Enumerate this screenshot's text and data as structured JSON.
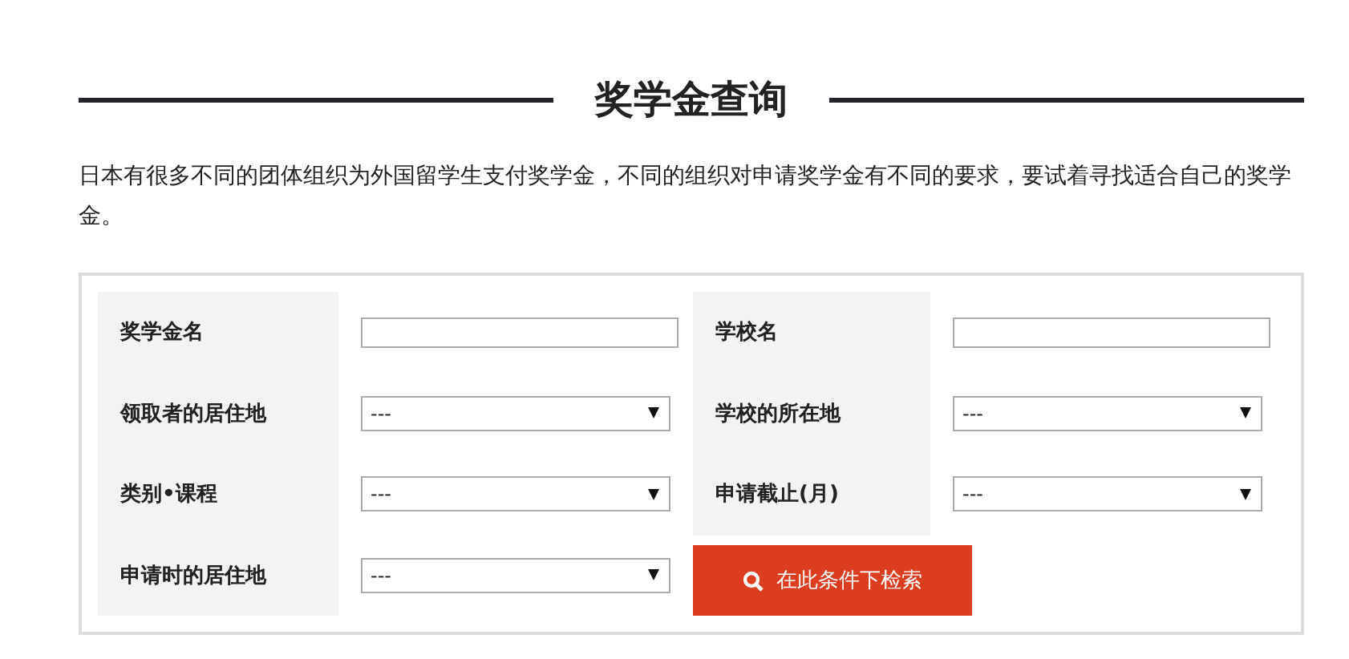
{
  "heading": "奖学金查询",
  "intro": "日本有很多不同的团体组织为外国留学生支付奖学金，不同的组织对申请奖学金有不同的要求，要试着寻找适合自己的奖学金。",
  "form": {
    "left": [
      {
        "label": "奖学金名",
        "kind": "text"
      },
      {
        "label": "领取者的居住地",
        "kind": "select",
        "value": "---"
      },
      {
        "label": "类别•课程",
        "kind": "select",
        "value": "---"
      },
      {
        "label": "申请时的居住地",
        "kind": "select",
        "value": "---"
      }
    ],
    "right": [
      {
        "label": "学校名",
        "kind": "text"
      },
      {
        "label": "学校的所在地",
        "kind": "select",
        "value": "---"
      },
      {
        "label": "申请截止(月)",
        "kind": "select",
        "value": "---"
      }
    ],
    "search_button": "在此条件下检索"
  }
}
